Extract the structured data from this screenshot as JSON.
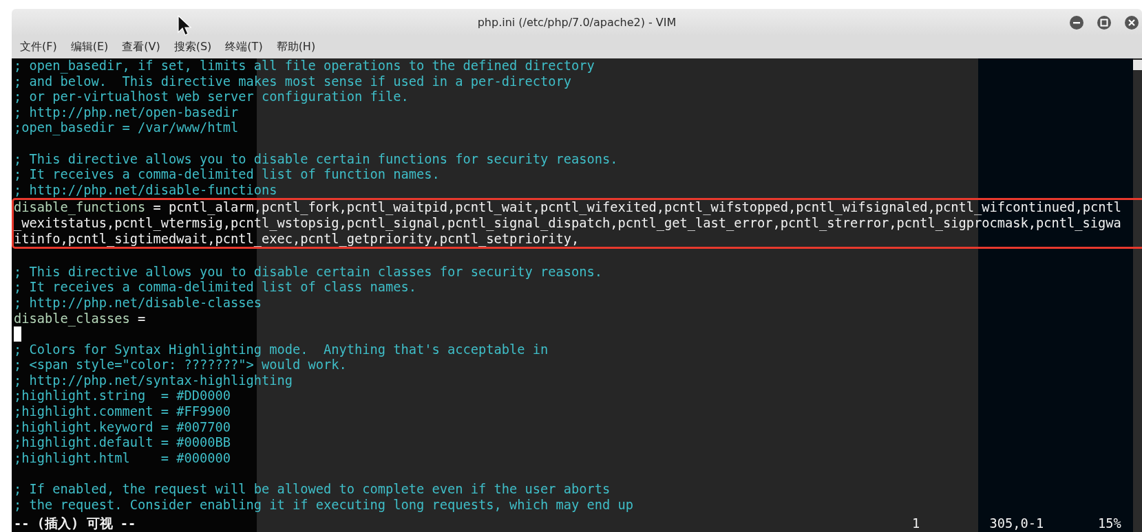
{
  "window": {
    "title": "php.ini (/etc/php/7.0/apache2) - VIM"
  },
  "menu": [
    {
      "label": "文件(F)"
    },
    {
      "label": "编辑(E)"
    },
    {
      "label": "查看(V)"
    },
    {
      "label": "搜索(S)"
    },
    {
      "label": "终端(T)"
    },
    {
      "label": "帮助(H)"
    }
  ],
  "buffer": {
    "lines": [
      {
        "kind": "comment",
        "text": "; open_basedir, if set, limits all file operations to the defined directory"
      },
      {
        "kind": "comment",
        "text": "; and below.  This directive makes most sense if used in a per-directory"
      },
      {
        "kind": "comment",
        "text": "; or per-virtualhost web server configuration file."
      },
      {
        "kind": "comment",
        "text": "; http://php.net/open-basedir"
      },
      {
        "kind": "comment",
        "text": ";open_basedir = /var/www/html"
      },
      {
        "kind": "blank"
      },
      {
        "kind": "comment",
        "text": "; This directive allows you to disable certain functions for security reasons."
      },
      {
        "kind": "comment",
        "text": "; It receives a comma-delimited list of function names."
      },
      {
        "kind": "comment",
        "text": "; http://php.net/disable-functions"
      },
      {
        "kind": "annotated",
        "lines": [
          {
            "kind": "directive",
            "key": "disable_functions",
            "value": "= pcntl_alarm,pcntl_fork,pcntl_waitpid,pcntl_wait,pcntl_wifexited,pcntl_wifstopped,pcntl_wifsignaled,pcntl_wifcontinued,pcntl"
          },
          {
            "kind": "continuation",
            "text": "_wexitstatus,pcntl_wtermsig,pcntl_wstopsig,pcntl_signal,pcntl_signal_dispatch,pcntl_get_last_error,pcntl_strerror,pcntl_sigprocmask,pcntl_sigwa"
          },
          {
            "kind": "continuation",
            "text": "itinfo,pcntl_sigtimedwait,pcntl_exec,pcntl_getpriority,pcntl_setpriority,"
          }
        ]
      },
      {
        "kind": "blank"
      },
      {
        "kind": "comment",
        "text": "; This directive allows you to disable certain classes for security reasons."
      },
      {
        "kind": "comment",
        "text": "; It receives a comma-delimited list of class names."
      },
      {
        "kind": "comment",
        "text": "; http://php.net/disable-classes"
      },
      {
        "kind": "directive",
        "key": "disable_classes",
        "value": "="
      },
      {
        "kind": "cursor"
      },
      {
        "kind": "comment",
        "text": "; Colors for Syntax Highlighting mode.  Anything that's acceptable in"
      },
      {
        "kind": "comment",
        "text": "; <span style=\"color: ???????\"> would work."
      },
      {
        "kind": "comment",
        "text": "; http://php.net/syntax-highlighting"
      },
      {
        "kind": "comment",
        "text": ";highlight.string  = #DD0000"
      },
      {
        "kind": "comment",
        "text": ";highlight.comment = #FF9900"
      },
      {
        "kind": "comment",
        "text": ";highlight.keyword = #007700"
      },
      {
        "kind": "comment",
        "text": ";highlight.default = #0000BB"
      },
      {
        "kind": "comment",
        "text": ";highlight.html    = #000000"
      },
      {
        "kind": "blank"
      },
      {
        "kind": "comment",
        "text": "; If enabled, the request will be allowed to complete even if the user aborts"
      },
      {
        "kind": "comment",
        "text": "; the request. Consider enabling it if executing long requests, which may end up"
      }
    ]
  },
  "status_line": {
    "mode": "-- (插入) 可视 --",
    "showcmd": "1",
    "ruler": "305,0-1",
    "scroll": "15%"
  }
}
